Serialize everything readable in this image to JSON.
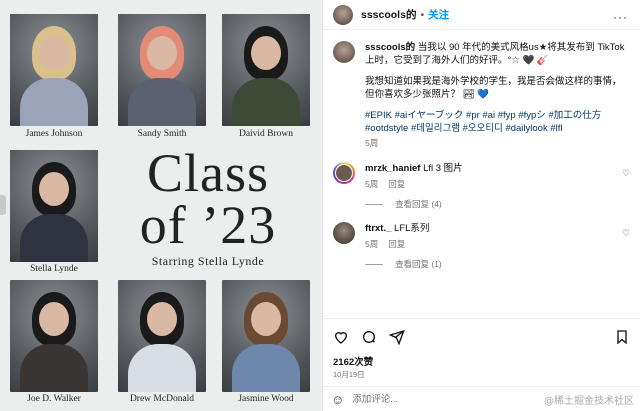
{
  "post": {
    "username": "ssscools的",
    "dot": "•",
    "follow_label": "关注",
    "more": "···"
  },
  "yearbook": {
    "title_line1": "Class",
    "title_line2": "of ’23",
    "subtitle": "Starring Stella Lynde",
    "students": [
      {
        "name": "James Johnson"
      },
      {
        "name": "Sandy Smith"
      },
      {
        "name": "Daivid Brown"
      },
      {
        "name": "Stella Lynde"
      },
      {
        "name": "Joe D. Walker"
      },
      {
        "name": "Drew McDonald"
      },
      {
        "name": "Jasmine Wood"
      }
    ]
  },
  "caption": {
    "username": "ssscools的",
    "para1": "当我以 90 年代的美式风格us★将其发布到 TikTok 上时，它受到了海外人们的好评。°☆ 🖤 🎸",
    "para2": "我想知道如果我是海外学校的学生，我是否会做这样的事情，但你喜欢多少张照片？ 🏞 💙",
    "tags": "#EPIK #aiイヤーブック #pr #ai #fyp #fypシ #加工の仕方 #ootdstyle #데일리그램 #오오티디 #dailylook #lfl",
    "time": "5周"
  },
  "comments": [
    {
      "username": "mrzk_hanief",
      "text": "Lfl 3 图片",
      "time": "5周",
      "reply": "回复",
      "view_replies": "查看回复 (4)"
    },
    {
      "username": "ftrxt._",
      "text": "LFL系列",
      "time": "5周",
      "reply": "回复",
      "view_replies": "查看回复 (1)"
    }
  ],
  "stats": {
    "likes": "2162次赞",
    "date": "10月19日"
  },
  "comment_box": {
    "placeholder": "添加评论..."
  },
  "watermark": "@稀土掘金技术社区",
  "colors": {
    "link": "#0095f6",
    "hashtag": "#00376b",
    "muted": "#737373"
  }
}
